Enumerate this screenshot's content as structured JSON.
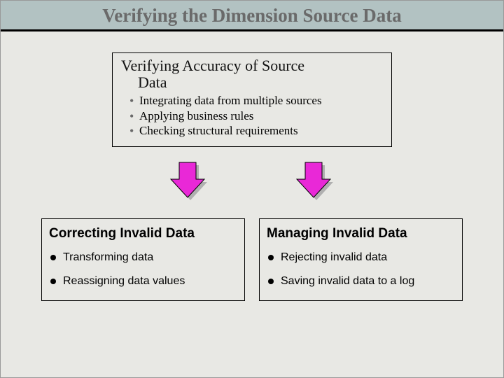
{
  "title": "Verifying the Dimension Source Data",
  "top_box": {
    "title_line1": "Verifying Accuracy of Source",
    "title_line2": "Data",
    "items": [
      "Integrating data from multiple sources",
      "Applying business rules",
      "Checking structural requirements"
    ]
  },
  "bottom_left": {
    "title": "Correcting Invalid Data",
    "items": [
      "Transforming data",
      "Reassigning data values"
    ]
  },
  "bottom_right": {
    "title": "Managing Invalid Data",
    "items": [
      "Rejecting invalid data",
      "Saving invalid data to a log"
    ]
  },
  "colors": {
    "arrow_fill": "#e928d7",
    "arrow_stroke": "#000",
    "arrow_shadow": "#b0b0b0"
  }
}
